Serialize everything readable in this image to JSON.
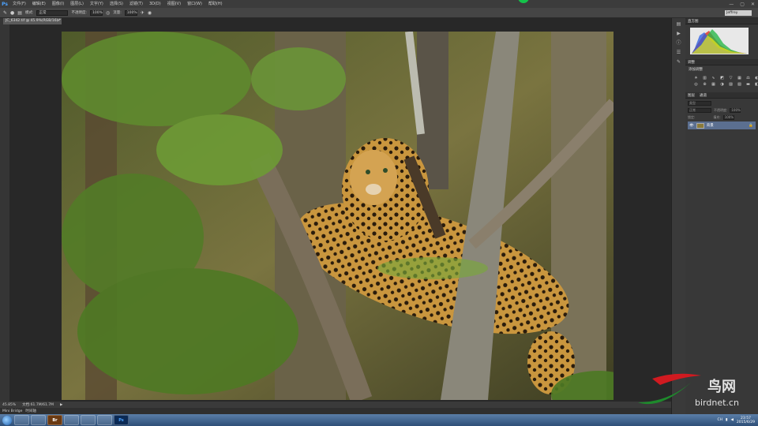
{
  "menubar": {
    "logo": "Ps",
    "items": [
      "文件(F)",
      "编辑(E)",
      "图像(I)",
      "图层(L)",
      "文字(Y)",
      "选择(S)",
      "滤镜(T)",
      "3D(D)",
      "视图(V)",
      "窗口(W)",
      "帮助(H)"
    ],
    "window_controls": [
      "—",
      "▢",
      "✕"
    ]
  },
  "options": {
    "mode_label": "模式:",
    "mode_value": "正常",
    "opacity_label": "不透明度:",
    "opacity_value": "100%",
    "flow_label": "流量:",
    "flow_value": "100%",
    "workspace": "Jeffrey"
  },
  "document": {
    "tab_title": "JC_6342.tif @ 45.9%(RGB/16) *",
    "close": "×"
  },
  "status": {
    "zoom": "45.85%",
    "doc_info": "文档:61.7M/61.7M",
    "arrow": "▶"
  },
  "minibridge": {
    "tabs": [
      "Mini Bridge",
      "时间轴"
    ]
  },
  "panels": {
    "histogram_tabs": [
      "直方图"
    ],
    "adjust_tabs": [
      "调整"
    ],
    "adjust_subtitle": "添加调整",
    "layers_tabs": [
      "图层",
      "通道"
    ],
    "blend_mode": "正常",
    "opacity_label": "不透明度:",
    "opacity_value": "100%",
    "lock_label": "锁定:",
    "fill_label": "填充:",
    "fill_value": "100%",
    "layer_name": "背景",
    "kind_label": "类型"
  },
  "taskbar": {
    "apps": [
      "",
      "",
      "Br",
      "",
      "",
      "",
      "Ps"
    ],
    "lang": "CH",
    "time": "23:57",
    "date": "2015/6/29"
  },
  "watermark": {
    "cn_text": "鸟网",
    "url": "birdnet.cn"
  },
  "colors": {
    "menubar_bg": "#3c3c3c",
    "canvas_bg": "#282828",
    "foreground_swatch": "#e0101a",
    "background_swatch": "#ffffff",
    "layer_selected": "#5b6f90",
    "ps_blue": "#4da3ff"
  }
}
